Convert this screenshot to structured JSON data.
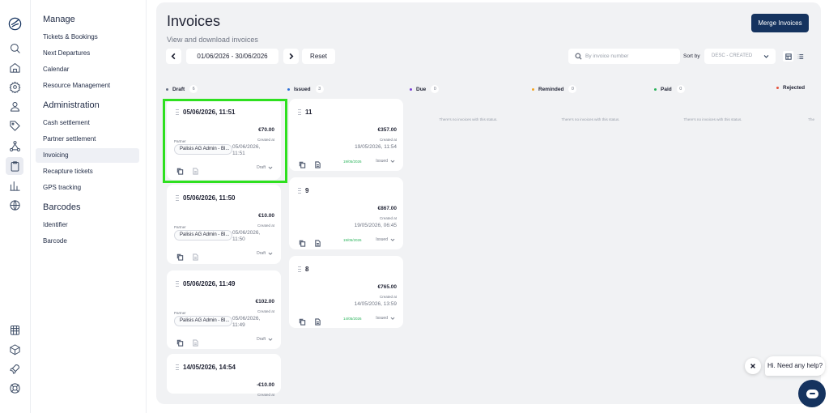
{
  "rail": {
    "top_icons": [
      "logo-icon",
      "search-icon",
      "home-icon",
      "settings-icon",
      "users-icon",
      "tag-icon",
      "network-icon",
      "clipboard-icon",
      "chart-icon",
      "globe-icon"
    ],
    "bottom_icons": [
      "calendar-grid-icon",
      "box-icon",
      "rocket-icon",
      "lifebuoy-icon"
    ]
  },
  "nav": {
    "sections": [
      {
        "title": "Manage",
        "items": [
          "Tickets & Bookings",
          "Next Departures",
          "Calendar",
          "Resource Management"
        ]
      },
      {
        "title": "Administration",
        "items": [
          "Cash settlement",
          "Partner settlement",
          "Invoicing",
          "Recapture tickets",
          "GPS tracking"
        ]
      },
      {
        "title": "Barcodes",
        "items": [
          "Identifier",
          "Barcode"
        ]
      }
    ],
    "active_item": "Invoicing"
  },
  "header": {
    "title": "Invoices",
    "subtitle": "View and download invoices",
    "merge_label": "Merge Invoices"
  },
  "toolbar": {
    "date_range": "01/06/2026 - 30/06/2026",
    "reset_label": "Reset",
    "search_placeholder": "By invoice number",
    "sort_label": "Sort by",
    "sort_value": "DESC - CREATED"
  },
  "columns": [
    {
      "name": "Draft",
      "count": "6",
      "dot_color": "#6a7385"
    },
    {
      "name": "Issued",
      "count": "3",
      "dot_color": "#2f6fd6"
    },
    {
      "name": "Due",
      "count": "0",
      "dot_color": "#7b3fd6"
    },
    {
      "name": "Reminded",
      "count": "0",
      "dot_color": "#f5a623"
    },
    {
      "name": "Paid",
      "count": "0",
      "dot_color": "#29b35a"
    },
    {
      "name": "Rejected",
      "count": "",
      "dot_color": "#e5533d"
    }
  ],
  "empty_text": "There's no invoices with this status.",
  "empty_text_cut": "The",
  "labels": {
    "partner": "Partner",
    "created_at": "Created at"
  },
  "draft_cards": [
    {
      "title": "05/06/2026, 11:51",
      "amount": "€70.00",
      "partner": "Palisis AG Admin - Bl...",
      "created_line1": "05/06/2026,",
      "created_line2": "11:51",
      "status": "Draft"
    },
    {
      "title": "05/06/2026, 11:50",
      "amount": "€10.00",
      "partner": "Palisis AG Admin - Bl...",
      "created_line1": "05/06/2026,",
      "created_line2": "11:50",
      "status": "Draft"
    },
    {
      "title": "05/06/2026, 11:49",
      "amount": "€102.00",
      "partner": "Palisis AG Admin - Bl...",
      "created_line1": "05/06/2026,",
      "created_line2": "11:49",
      "status": "Draft"
    },
    {
      "title": "14/05/2026, 14:54",
      "amount": "-€10.00"
    }
  ],
  "issued_cards": [
    {
      "title": "11",
      "amount": "€357.00",
      "created": "19/05/2026, 11:54",
      "status_date": "19/05/2026",
      "status": "Issued"
    },
    {
      "title": "9",
      "amount": "€867.00",
      "created": "19/05/2026, 06:45",
      "status_date": "19/05/2026",
      "status": "Issued"
    },
    {
      "title": "8",
      "amount": "€765.00",
      "created": "14/05/2026, 13:59",
      "status_date": "14/05/2026",
      "status": "Issued"
    }
  ],
  "help": {
    "bubble": "Hi. Need any help?"
  },
  "colors": {
    "primary": "#15335f",
    "highlight": "#2ee01f",
    "issued_green": "#29b35a"
  }
}
